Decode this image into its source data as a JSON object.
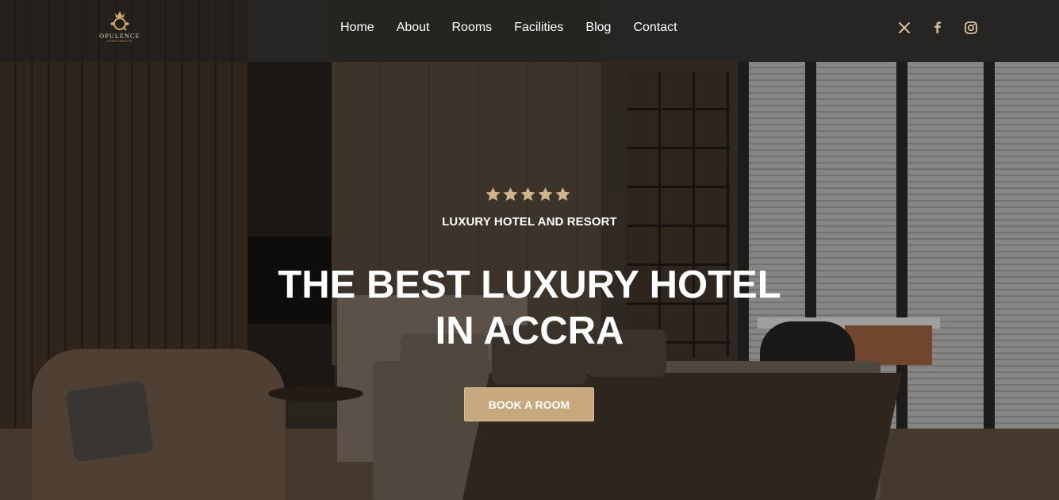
{
  "brand": {
    "name": "OPULENCE",
    "tagline": "APARTMENTS"
  },
  "nav": {
    "items": [
      {
        "label": "Home"
      },
      {
        "label": "About"
      },
      {
        "label": "Rooms"
      },
      {
        "label": "Facilities"
      },
      {
        "label": "Blog"
      },
      {
        "label": "Contact"
      }
    ]
  },
  "social": [
    {
      "icon": "x-twitter-icon"
    },
    {
      "icon": "facebook-icon"
    },
    {
      "icon": "instagram-icon"
    }
  ],
  "hero": {
    "rating": 5,
    "eyebrow": "LUXURY HOTEL AND RESORT",
    "title_line1": "THE BEST LUXURY HOTEL",
    "title_line2": "IN ACCRA",
    "cta_label": "BOOK A ROOM"
  },
  "colors": {
    "accent": "#c8a97d",
    "star": "#d2b48c",
    "header_bg": "#1e1e1e"
  }
}
